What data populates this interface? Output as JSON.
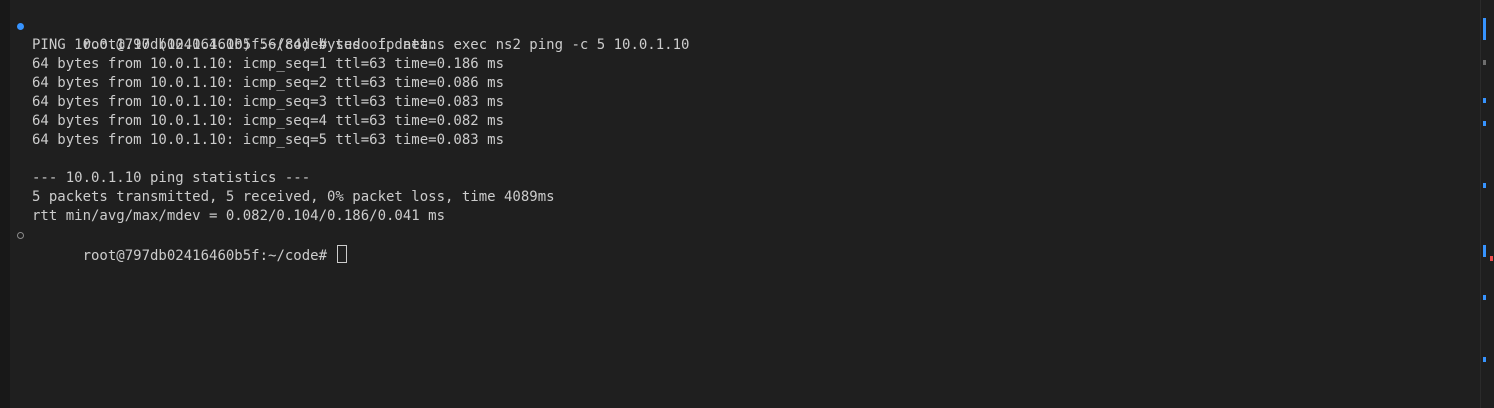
{
  "terminal": {
    "lines": [
      "root@797db02416460b5f:~/code# sudo ip netns exec ns2 ping -c 5 10.0.1.10",
      "PING 10.0.1.10 (10.0.1.10) 56(84) bytes of data.",
      "64 bytes from 10.0.1.10: icmp_seq=1 ttl=63 time=0.186 ms",
      "64 bytes from 10.0.1.10: icmp_seq=2 ttl=63 time=0.086 ms",
      "64 bytes from 10.0.1.10: icmp_seq=3 ttl=63 time=0.083 ms",
      "64 bytes from 10.0.1.10: icmp_seq=4 ttl=63 time=0.082 ms",
      "64 bytes from 10.0.1.10: icmp_seq=5 ttl=63 time=0.083 ms",
      "",
      "--- 10.0.1.10 ping statistics ---",
      "5 packets transmitted, 5 received, 0% packet loss, time 4089ms",
      "rtt min/avg/max/mdev = 0.082/0.104/0.186/0.041 ms"
    ],
    "prompt": "root@797db02416460b5f:~/code# ",
    "colors": {
      "background": "#1f1f1f",
      "foreground": "#cccccc",
      "success_decoration": "#3794ff",
      "default_decoration": "#8b8b8b",
      "error_mark": "#f14c4c"
    }
  }
}
